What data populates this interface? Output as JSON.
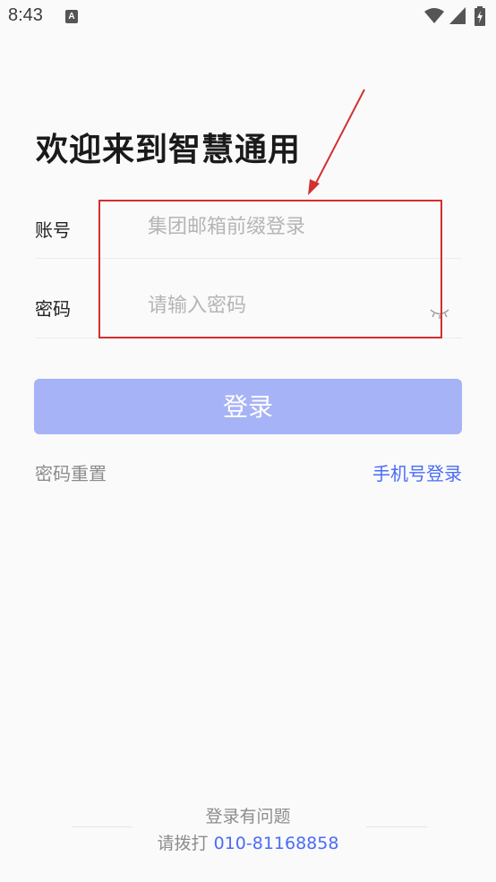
{
  "status_bar": {
    "time": "8:43",
    "notification_icon": "A",
    "icons": [
      "app-notification-icon",
      "wifi-icon",
      "signal-icon",
      "battery-charging-icon"
    ]
  },
  "page": {
    "title": "欢迎来到智慧通用"
  },
  "form": {
    "account": {
      "label": "账号",
      "placeholder": "集团邮箱前缀登录",
      "value": ""
    },
    "password": {
      "label": "密码",
      "placeholder": "请输入密码",
      "value": "",
      "toggle_icon": "eye-closed-icon"
    },
    "login_button": "登录"
  },
  "links": {
    "reset_password": "密码重置",
    "phone_login": "手机号登录"
  },
  "footer": {
    "title": "登录有问题",
    "contact_prefix": "请拨打",
    "phone": "010-81168858"
  },
  "colors": {
    "accent": "#4a6cf7",
    "button": "#a6b3f6",
    "annotation": "#d32f2f"
  }
}
